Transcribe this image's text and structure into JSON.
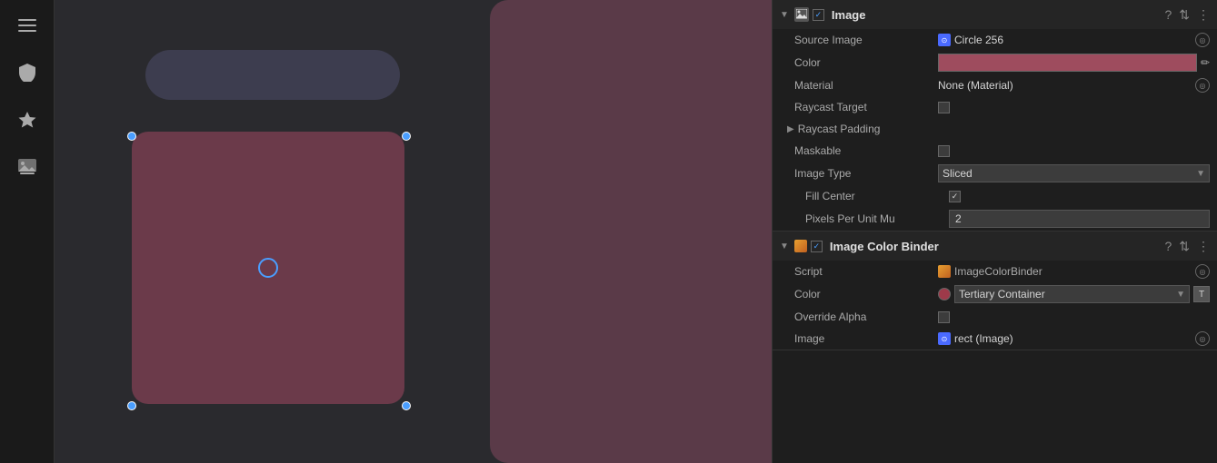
{
  "sidebar": {
    "icons": [
      {
        "name": "menu-icon",
        "symbol": "≡"
      },
      {
        "name": "shield-icon",
        "symbol": "🛡"
      },
      {
        "name": "star-icon",
        "symbol": "★"
      },
      {
        "name": "image-icon",
        "symbol": "🖼"
      }
    ]
  },
  "image_component": {
    "title": "Image",
    "source_image_label": "Source Image",
    "source_image_value": "Circle 256",
    "color_label": "Color",
    "material_label": "Material",
    "material_value": "None (Material)",
    "raycast_target_label": "Raycast Target",
    "raycast_padding_label": "Raycast Padding",
    "maskable_label": "Maskable",
    "image_type_label": "Image Type",
    "image_type_value": "Sliced",
    "fill_center_label": "Fill Center",
    "pixels_per_unit_label": "Pixels Per Unit Mu",
    "pixels_per_unit_value": "2"
  },
  "color_binder_component": {
    "title": "Image Color Binder",
    "script_label": "Script",
    "script_value": "ImageColorBinder",
    "color_label": "Color",
    "color_dropdown_value": "Tertiary Container",
    "override_alpha_label": "Override Alpha",
    "image_label": "Image",
    "image_value": "rect (Image)"
  }
}
